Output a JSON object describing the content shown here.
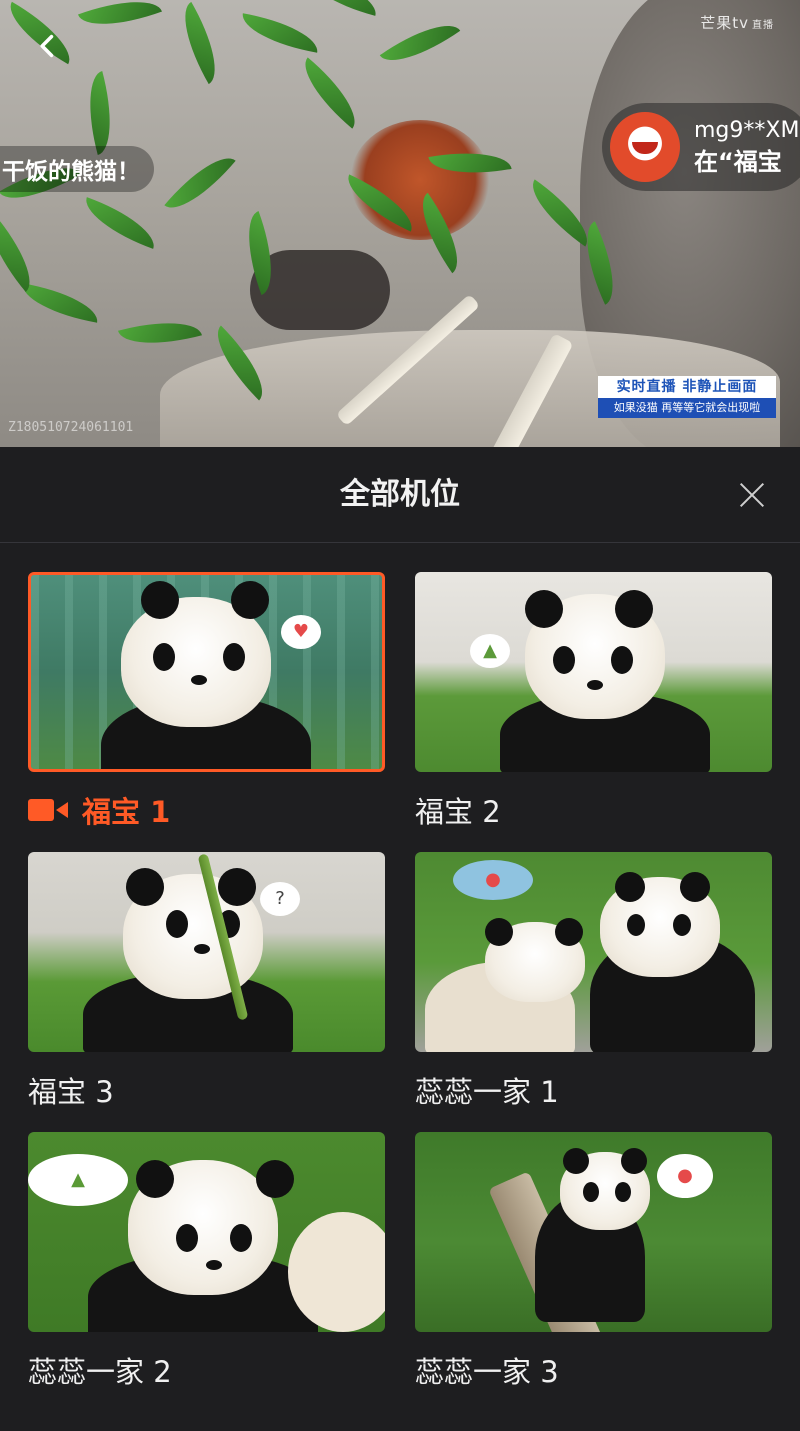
{
  "video": {
    "ticker_text": "干饭的熊猫！",
    "brand": "芒果tv",
    "brand_sub": "直播",
    "user": {
      "name": "mg9**XM",
      "message": "在“福宝"
    },
    "live_badge": {
      "line1": "实时直播 非静止画面",
      "line2": "如果没猫 再等等它就会出现啦"
    },
    "timestamp": "Z180510724061101"
  },
  "panel": {
    "title": "全部机位",
    "cameras": [
      {
        "label": "福宝 1",
        "active": true
      },
      {
        "label": "福宝 2",
        "active": false
      },
      {
        "label": "福宝 3",
        "active": false
      },
      {
        "label": "蕊蕊一家 1",
        "active": false
      },
      {
        "label": "蕊蕊一家 2",
        "active": false
      },
      {
        "label": "蕊蕊一家 3",
        "active": false
      }
    ]
  },
  "icons": {
    "back": "chevron-left-icon",
    "close": "close-icon",
    "active_camera": "video-camera-icon"
  },
  "colors": {
    "accent": "#ff5a26",
    "panel_bg": "#1e1e20",
    "live_badge_blue": "#1e4fb5"
  }
}
